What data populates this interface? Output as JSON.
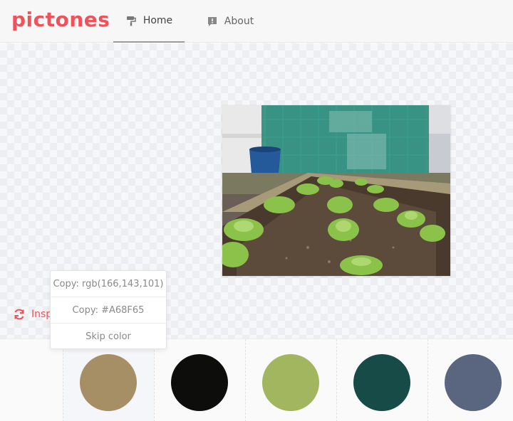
{
  "app": {
    "logo_text": "pictones"
  },
  "nav": {
    "home_label": "Home",
    "about_label": "About"
  },
  "inspire": {
    "label": "Inspire"
  },
  "context_menu": {
    "copy_rgb": "Copy: rgb(166,143,101)",
    "copy_hex": "Copy: #A68F65",
    "skip": "Skip color"
  },
  "palette": {
    "colors": [
      "#A68F65",
      "#0D0D0B",
      "#A2B660",
      "#174B48",
      "#5A6680"
    ],
    "selected_index": 0
  },
  "theme": {
    "accent": "#F0525A"
  },
  "icons": {
    "home": "paint-roller-icon",
    "about": "info-icon",
    "inspire": "refresh-icon"
  }
}
